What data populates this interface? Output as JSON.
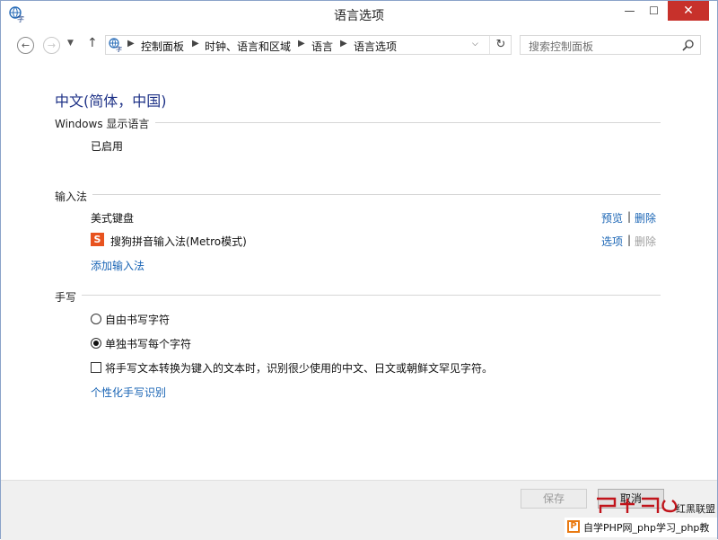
{
  "window": {
    "title": "语言选项",
    "min_glyph": "—",
    "max_glyph": "☐",
    "close_glyph": "✕"
  },
  "nav": {
    "back_glyph": "←",
    "forward_glyph": "→",
    "recent_glyph": "▼",
    "up_glyph": "↑",
    "breadcrumbs": [
      "控制面板",
      "时钟、语言和区域",
      "语言",
      "语言选项"
    ],
    "breadcrumb_sep": "▶",
    "dropdown_glyph": "⌵",
    "refresh_glyph": "↻",
    "search_placeholder": "搜索控制面板"
  },
  "main": {
    "title": "中文(简体，中国)",
    "windows_language": {
      "heading": "Windows 显示语言",
      "status": "已启用"
    },
    "input_methods": {
      "heading": "输入法",
      "items": [
        {
          "name": "美式键盘",
          "action1": "预览",
          "separator": "|",
          "action2": "删除",
          "action2_enabled": true
        },
        {
          "name": "搜狗拼音输入法(Metro模式)",
          "icon_letter": "S",
          "action1": "选项",
          "separator": "|",
          "action2": "删除",
          "action2_enabled": false
        }
      ],
      "add_link": "添加输入法"
    },
    "handwriting": {
      "heading": "手写",
      "options": [
        {
          "label": "自由书写字符",
          "selected": false
        },
        {
          "label": "单独书写每个字符",
          "selected": true
        }
      ],
      "checkbox_label": "将手写文本转换为键入的文本时，识别很少使用的中文、日文或朝鲜文罕见字符。",
      "checkbox_checked": false,
      "personalize_link": "个性化手写识别"
    }
  },
  "footer": {
    "save_label": "保存",
    "cancel_label": "取消"
  },
  "watermark": {
    "side_text": "红黑联盟",
    "p_letter": "P",
    "bar_text": "自学PHP网_php学习_php教"
  },
  "colors": {
    "link": "#1a65b5",
    "title": "#1e3287",
    "close_button": "#c7312b",
    "sogou": "#e8531f"
  }
}
